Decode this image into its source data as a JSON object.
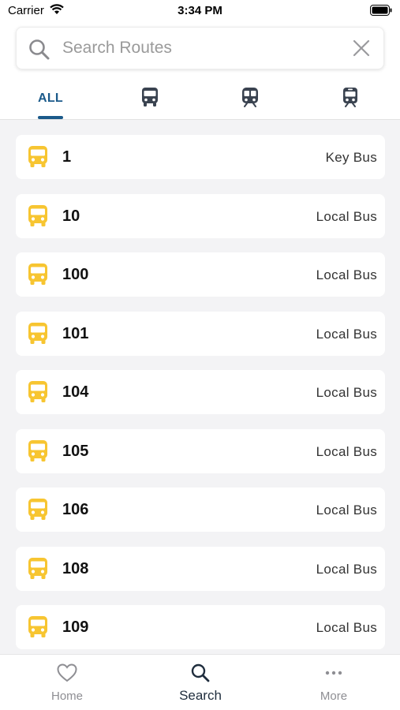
{
  "status_bar": {
    "carrier": "Carrier",
    "time": "3:34 PM"
  },
  "search": {
    "placeholder": "Search Routes",
    "value": ""
  },
  "tabs": [
    {
      "label": "ALL",
      "active": true
    },
    {
      "icon": "bus-icon"
    },
    {
      "icon": "subway-icon"
    },
    {
      "icon": "train-icon"
    }
  ],
  "routes": [
    {
      "number": "1",
      "type": "Key Bus",
      "icon": "bus-icon"
    },
    {
      "number": "10",
      "type": "Local Bus",
      "icon": "bus-icon"
    },
    {
      "number": "100",
      "type": "Local Bus",
      "icon": "bus-icon"
    },
    {
      "number": "101",
      "type": "Local Bus",
      "icon": "bus-icon"
    },
    {
      "number": "104",
      "type": "Local Bus",
      "icon": "bus-icon"
    },
    {
      "number": "105",
      "type": "Local Bus",
      "icon": "bus-icon"
    },
    {
      "number": "106",
      "type": "Local Bus",
      "icon": "bus-icon"
    },
    {
      "number": "108",
      "type": "Local Bus",
      "icon": "bus-icon"
    },
    {
      "number": "109",
      "type": "Local Bus",
      "icon": "bus-icon"
    }
  ],
  "bottom_nav": [
    {
      "label": "Home",
      "icon": "heart-icon",
      "active": false
    },
    {
      "label": "Search",
      "icon": "search-icon",
      "active": true
    },
    {
      "label": "More",
      "icon": "more-dots-icon",
      "active": false
    }
  ],
  "colors": {
    "accent": "#1b5a8a",
    "bus": "#f7c531",
    "tab_icon": "#3a4350"
  }
}
